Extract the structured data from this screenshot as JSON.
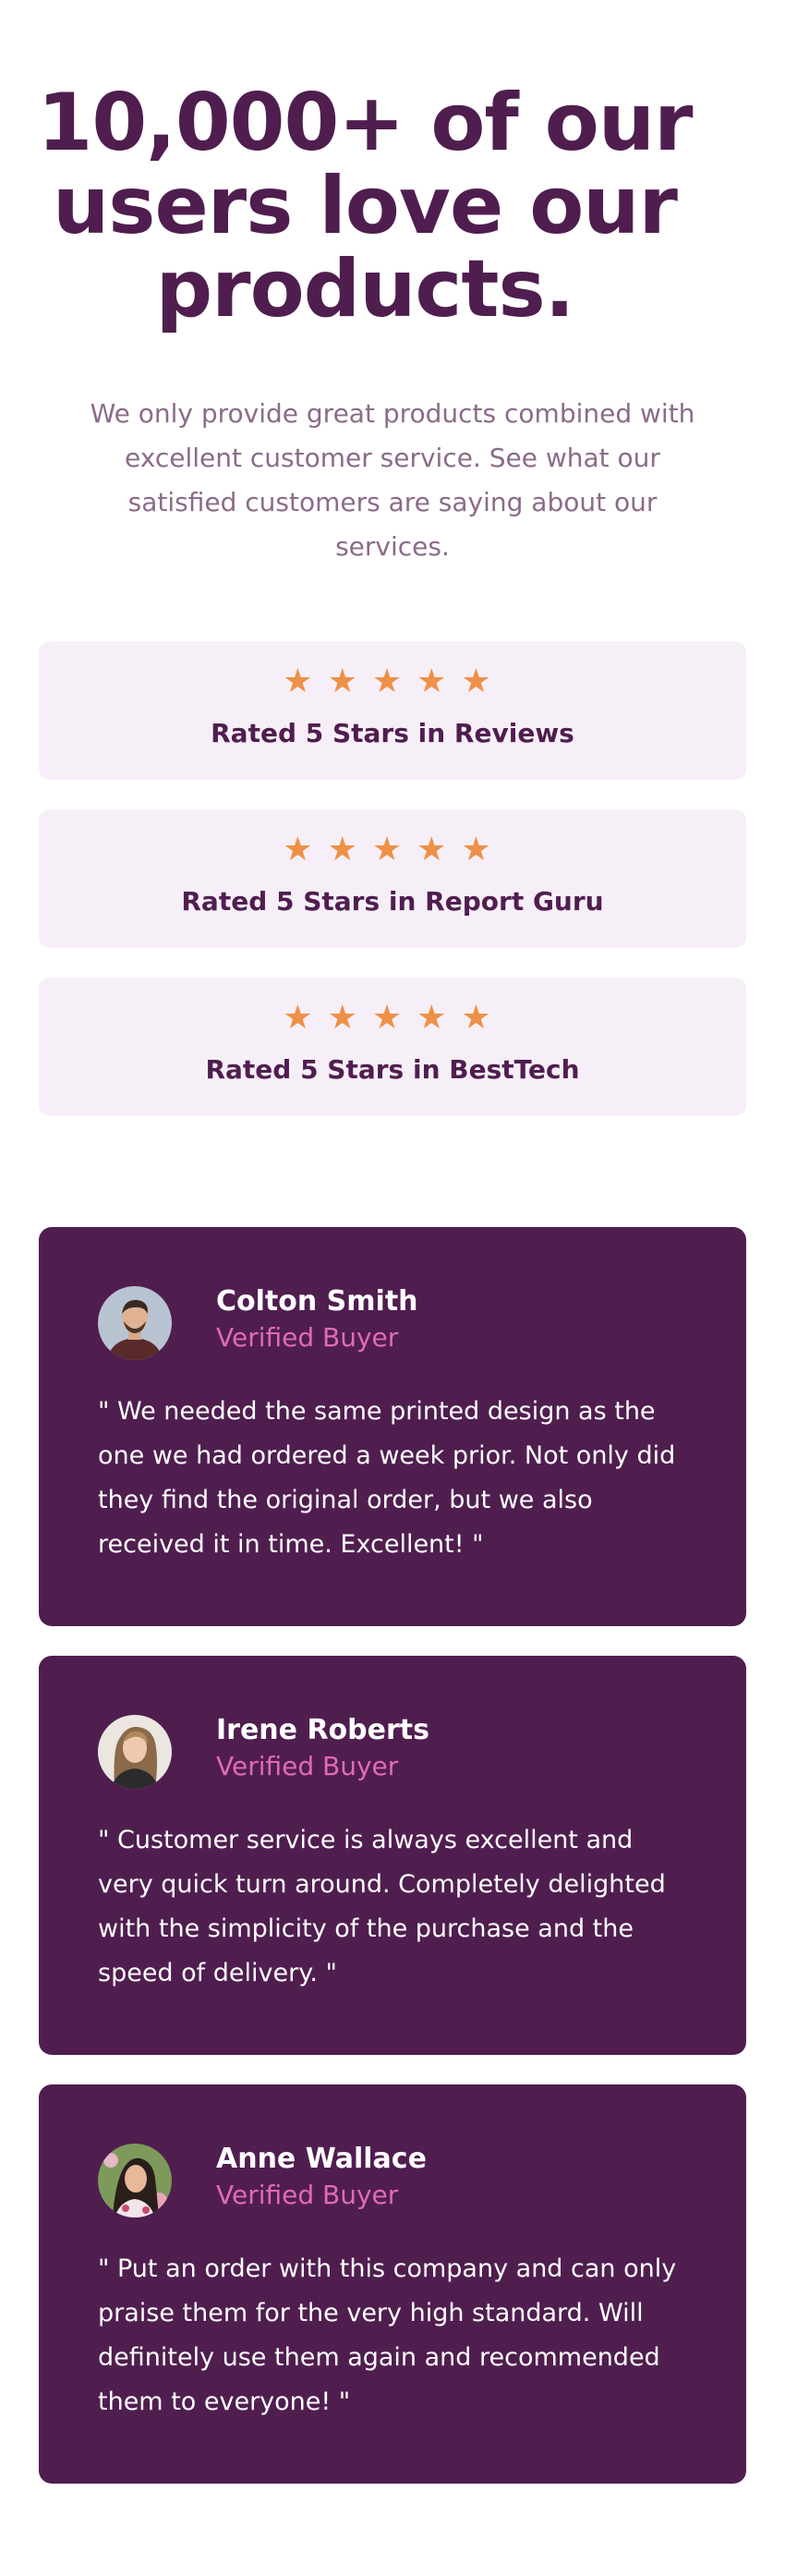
{
  "hero": {
    "title": "10,000+ of our users love our products.",
    "description": "We only provide great products combined with excellent customer service. See what our satisfied customers are saying about our services."
  },
  "ratings": [
    {
      "label": "Rated 5 Stars in Reviews",
      "stars": 5
    },
    {
      "label": "Rated 5 Stars in Report Guru",
      "stars": 5
    },
    {
      "label": "Rated 5 Stars in BestTech",
      "stars": 5
    }
  ],
  "testimonials": [
    {
      "name": "Colton Smith",
      "badge": "Verified Buyer",
      "text": "\" We needed the same printed design as the one we had ordered a week prior. Not only did they find the original order, but we also received it in time. Excellent! \""
    },
    {
      "name": "Irene Roberts",
      "badge": "Verified Buyer",
      "text": "\" Customer service is always excellent and very quick turn around. Completely delighted with the simplicity of the purchase and the speed of delivery. \""
    },
    {
      "name": "Anne Wallace",
      "badge": "Verified Buyer",
      "text": "\" Put an order with this company and can only praise them for the very high standard. Will definitely use them again and recommended them to everyone! \""
    }
  ],
  "colors": {
    "heading": "#4f1e4f",
    "body_text": "#8b6b8a",
    "rating_card_bg": "#f7eff7",
    "star": "#ee9048",
    "review_card_bg": "#4f1e4f",
    "badge": "#e06bb3"
  },
  "icons": {
    "star": "star-icon"
  }
}
